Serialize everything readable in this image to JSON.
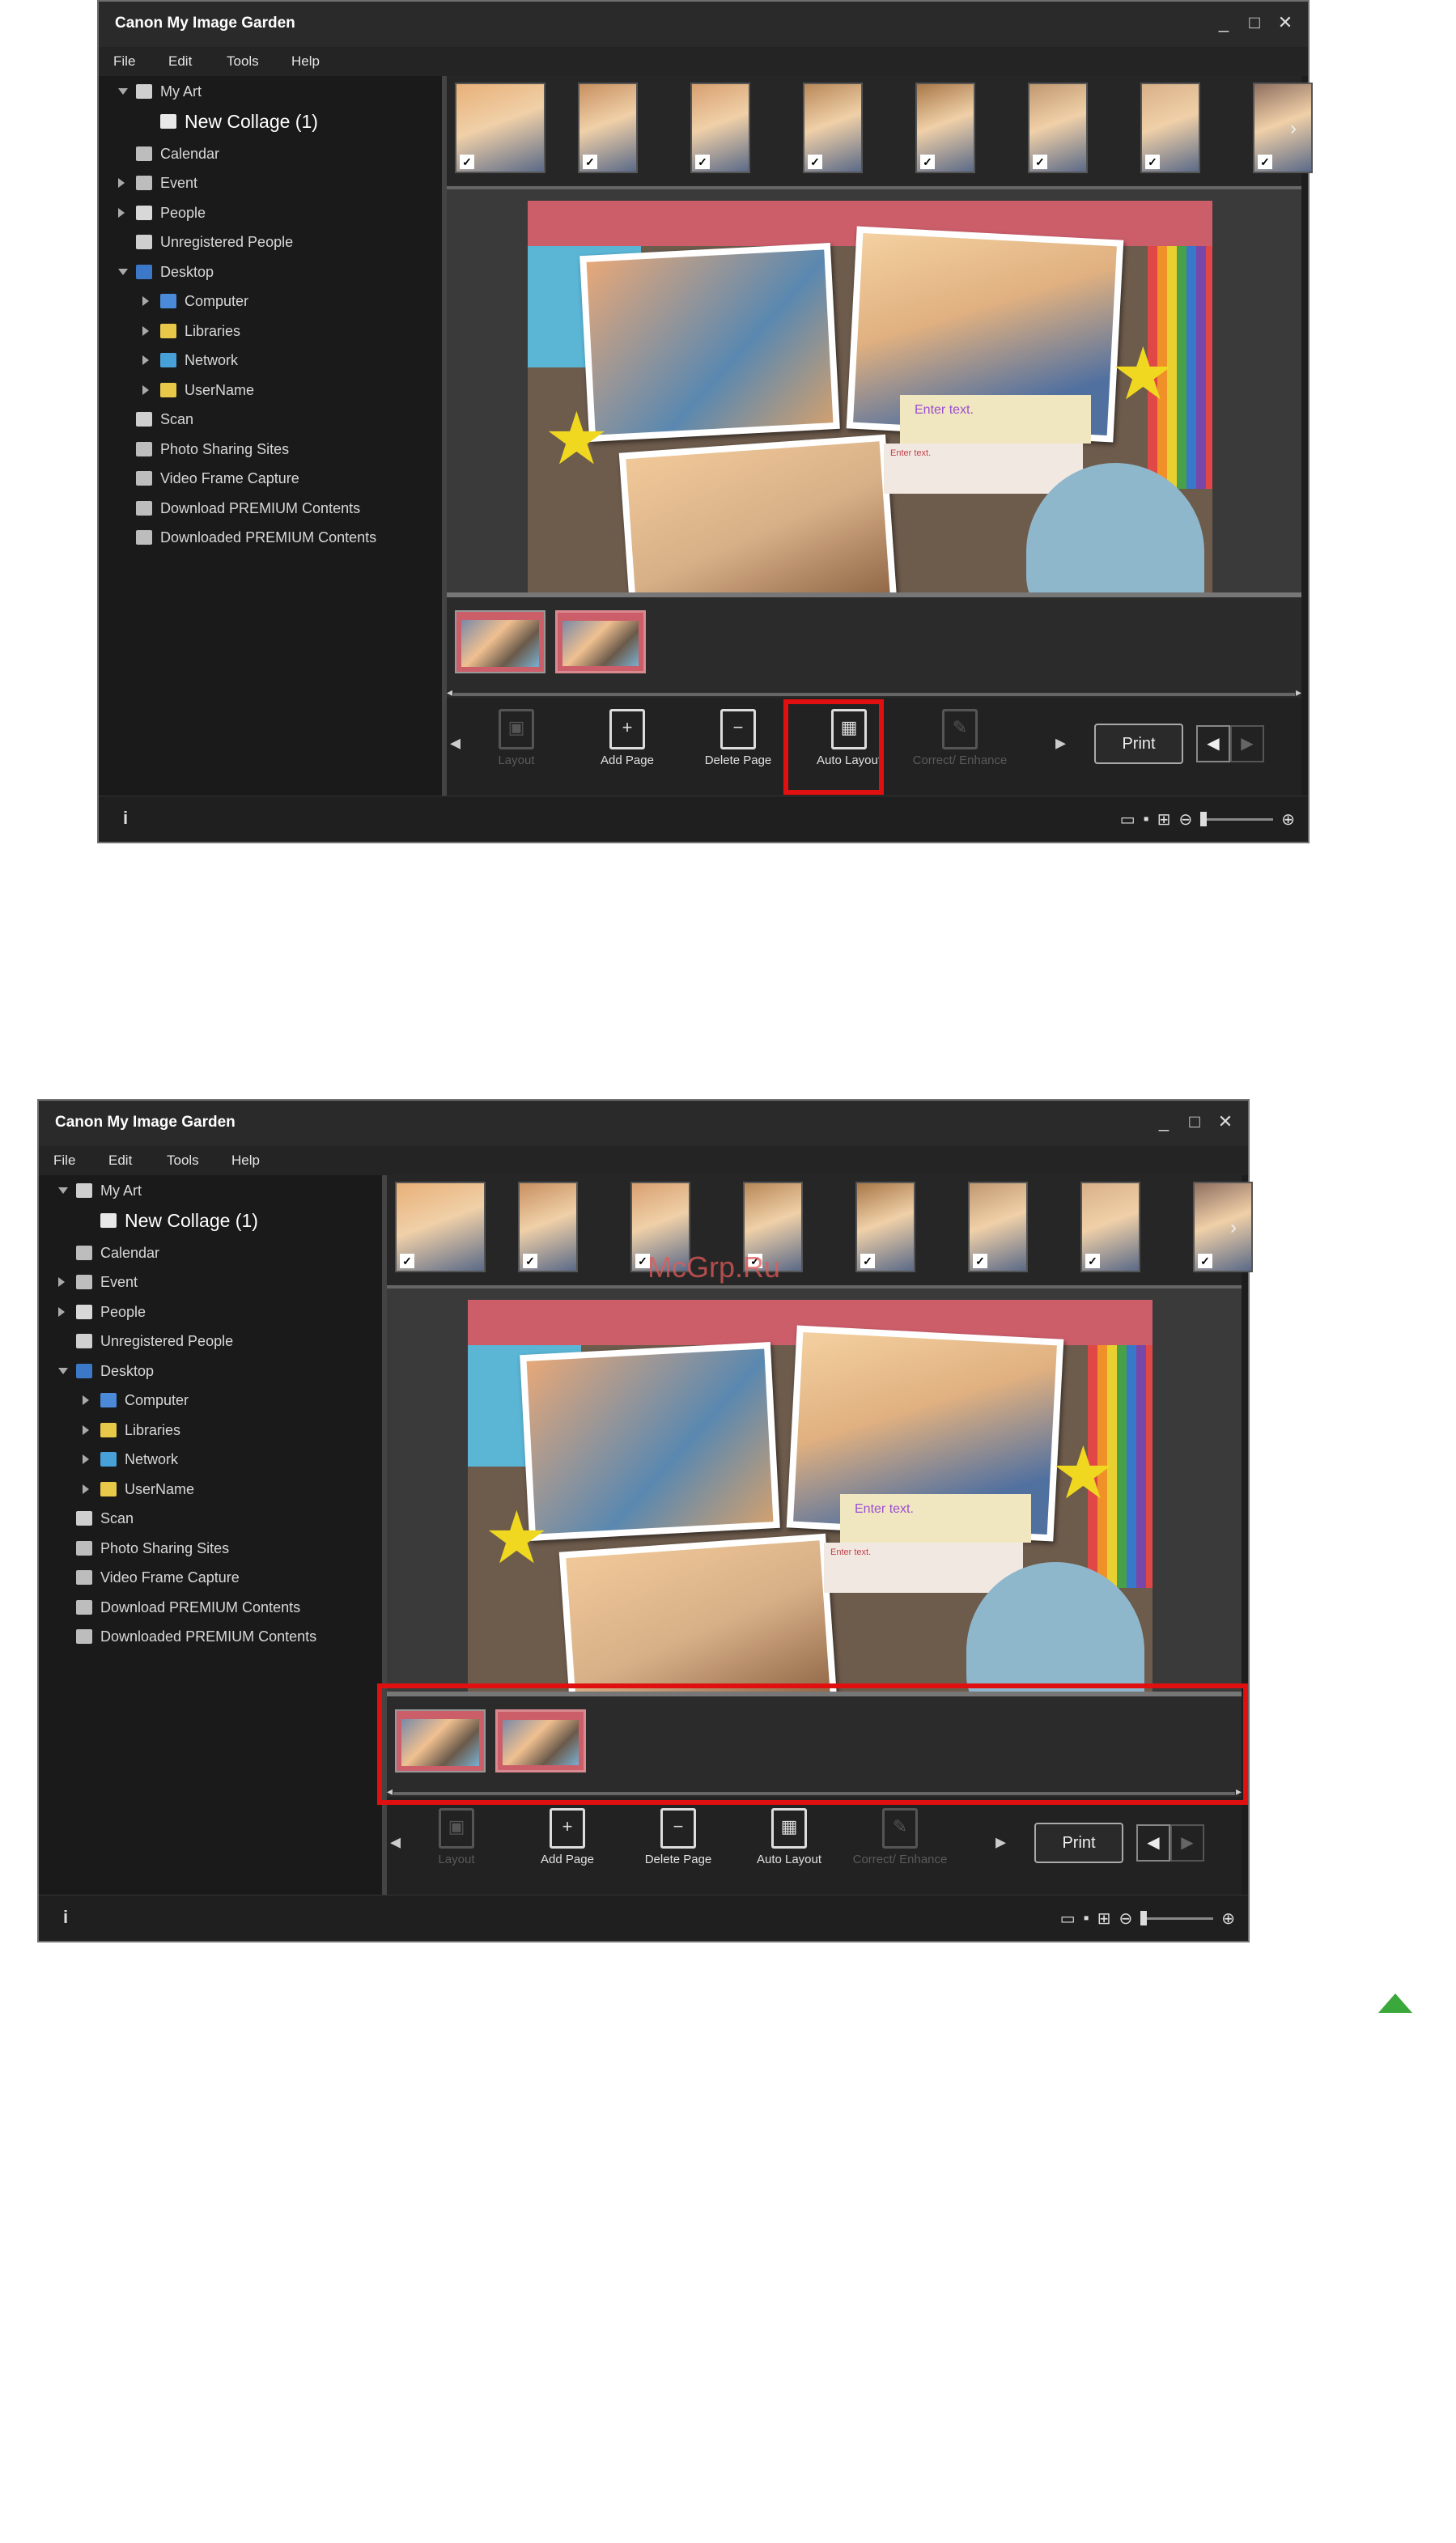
{
  "screenshots": [
    {
      "app_title": "Canon My Image Garden",
      "window_buttons": [
        "_",
        "□",
        "✕"
      ],
      "menu": [
        "File",
        "Edit",
        "Tools",
        "Help"
      ],
      "tree": [
        {
          "label": "My Art",
          "expander": "down",
          "level": 0,
          "icon": "my-art-icon"
        },
        {
          "label": "New Collage (1)",
          "expander": "",
          "level": 1,
          "icon": "collage-icon",
          "selected": true
        },
        {
          "label": "Calendar",
          "expander": "",
          "level": 0,
          "icon": "calendar-icon"
        },
        {
          "label": "Event",
          "expander": "right",
          "level": 0,
          "icon": "event-icon"
        },
        {
          "label": "People",
          "expander": "right",
          "level": 0,
          "icon": "people-icon"
        },
        {
          "label": "Unregistered People",
          "expander": "",
          "level": 0,
          "icon": "unregistered-people-icon"
        },
        {
          "label": "Desktop",
          "expander": "down",
          "level": 0,
          "icon": "desktop-icon"
        },
        {
          "label": "Computer",
          "expander": "right",
          "level": 1,
          "icon": "computer-icon"
        },
        {
          "label": "Libraries",
          "expander": "right",
          "level": 1,
          "icon": "libraries-icon"
        },
        {
          "label": "Network",
          "expander": "right",
          "level": 1,
          "icon": "network-icon"
        },
        {
          "label": "UserName",
          "expander": "right",
          "level": 1,
          "icon": "user-folder-icon"
        },
        {
          "label": "Scan",
          "expander": "",
          "level": 0,
          "icon": "scan-icon"
        },
        {
          "label": "Photo Sharing Sites",
          "expander": "",
          "level": 0,
          "icon": "photo-sharing-icon"
        },
        {
          "label": "Video Frame Capture",
          "expander": "",
          "level": 0,
          "icon": "video-frame-icon"
        },
        {
          "label": "Download PREMIUM Contents",
          "expander": "",
          "level": 0,
          "icon": "download-premium-icon"
        },
        {
          "label": "Downloaded PREMIUM Contents",
          "expander": "",
          "level": 0,
          "icon": "downloaded-premium-icon"
        }
      ],
      "thumbnails": [
        {
          "checked": true,
          "orientation": "landscape"
        },
        {
          "checked": true,
          "orientation": "portrait"
        },
        {
          "checked": true,
          "orientation": "portrait"
        },
        {
          "checked": true,
          "orientation": "portrait"
        },
        {
          "checked": true,
          "orientation": "portrait"
        },
        {
          "checked": true,
          "orientation": "portrait"
        },
        {
          "checked": true,
          "orientation": "portrait"
        },
        {
          "checked": true,
          "orientation": "portrait"
        }
      ],
      "collage_text": {
        "enter_text": "Enter text.",
        "enter_text_small": "Enter text."
      },
      "page_thumbs": 2,
      "toolbar": [
        {
          "label": "Layout",
          "enabled": false,
          "icon": "layout-icon"
        },
        {
          "label": "Add Page",
          "enabled": true,
          "icon": "add-page-icon"
        },
        {
          "label": "Delete Page",
          "enabled": true,
          "icon": "delete-page-icon"
        },
        {
          "label": "Auto Layout",
          "enabled": true,
          "icon": "auto-layout-icon"
        },
        {
          "label": "Correct/ Enhance",
          "enabled": false,
          "icon": "correct-enhance-icon"
        }
      ],
      "print_label": "Print",
      "highlight": "delete-page"
    },
    {
      "app_title": "Canon My Image Garden",
      "window_buttons": [
        "_",
        "□",
        "✕"
      ],
      "menu": [
        "File",
        "Edit",
        "Tools",
        "Help"
      ],
      "tree_same_as_first": true,
      "collage_text": {
        "enter_text": "Enter text.",
        "enter_text_small": "Enter text."
      },
      "toolbar": [
        {
          "label": "Layout",
          "enabled": false
        },
        {
          "label": "Add Page",
          "enabled": true
        },
        {
          "label": "Delete Page",
          "enabled": true
        },
        {
          "label": "Auto Layout",
          "enabled": true
        },
        {
          "label": "Correct/ Enhance",
          "enabled": false
        }
      ],
      "print_label": "Print",
      "highlight": "page-strip"
    }
  ],
  "watermark": "McGrp.Ru",
  "colors": {
    "highlight": "#e01010",
    "to_top_arrow": "#3aa83a",
    "window_bg": "#1d1d1d"
  }
}
